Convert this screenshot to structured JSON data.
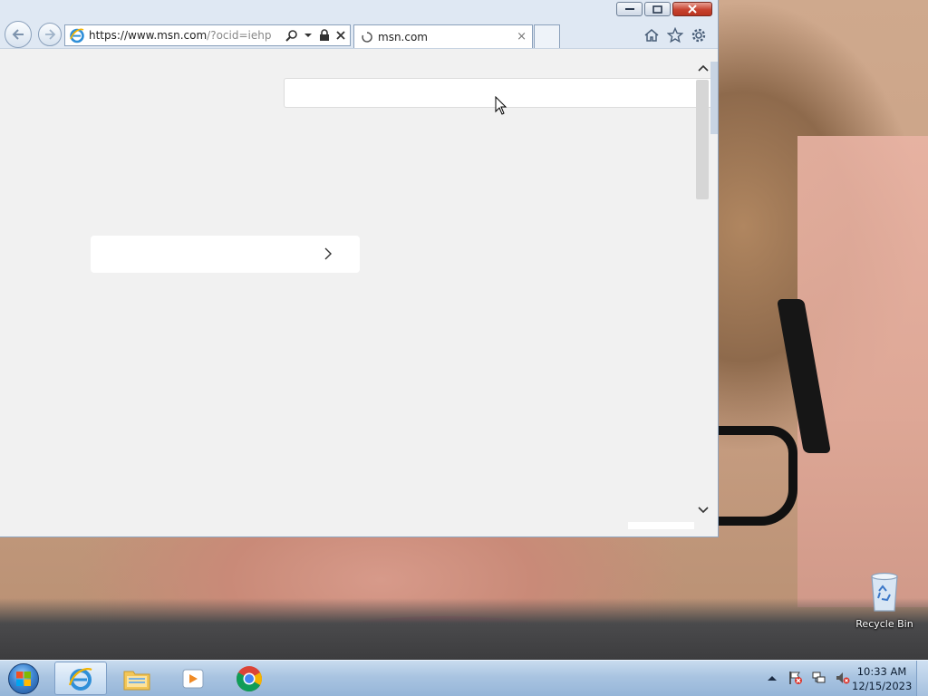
{
  "browser": {
    "url_prefix": "https://",
    "url_host": "www.msn.com",
    "url_path": "/?ocid=iehp",
    "tab_title": "msn.com",
    "tab_close": "×"
  },
  "desktop": {
    "icons": [
      {
        "label": "Recycle Bin",
        "icon": "recycle-bin-icon"
      }
    ]
  },
  "taskbar": {
    "pinned": [
      {
        "name": "internet-explorer",
        "icon": "ie-icon",
        "active": true
      },
      {
        "name": "windows-explorer",
        "icon": "folder-icon",
        "active": false
      },
      {
        "name": "media-player",
        "icon": "media-player-icon",
        "active": false
      },
      {
        "name": "chrome",
        "icon": "chrome-icon",
        "active": false
      }
    ],
    "clock_time": "10:33 AM",
    "clock_date": "12/15/2023"
  },
  "colors": {
    "page_bg": "#f1f1f1",
    "frame": "#dfe8f3",
    "close_red": "#c7422f",
    "taskbar": "#a9c4e1"
  }
}
